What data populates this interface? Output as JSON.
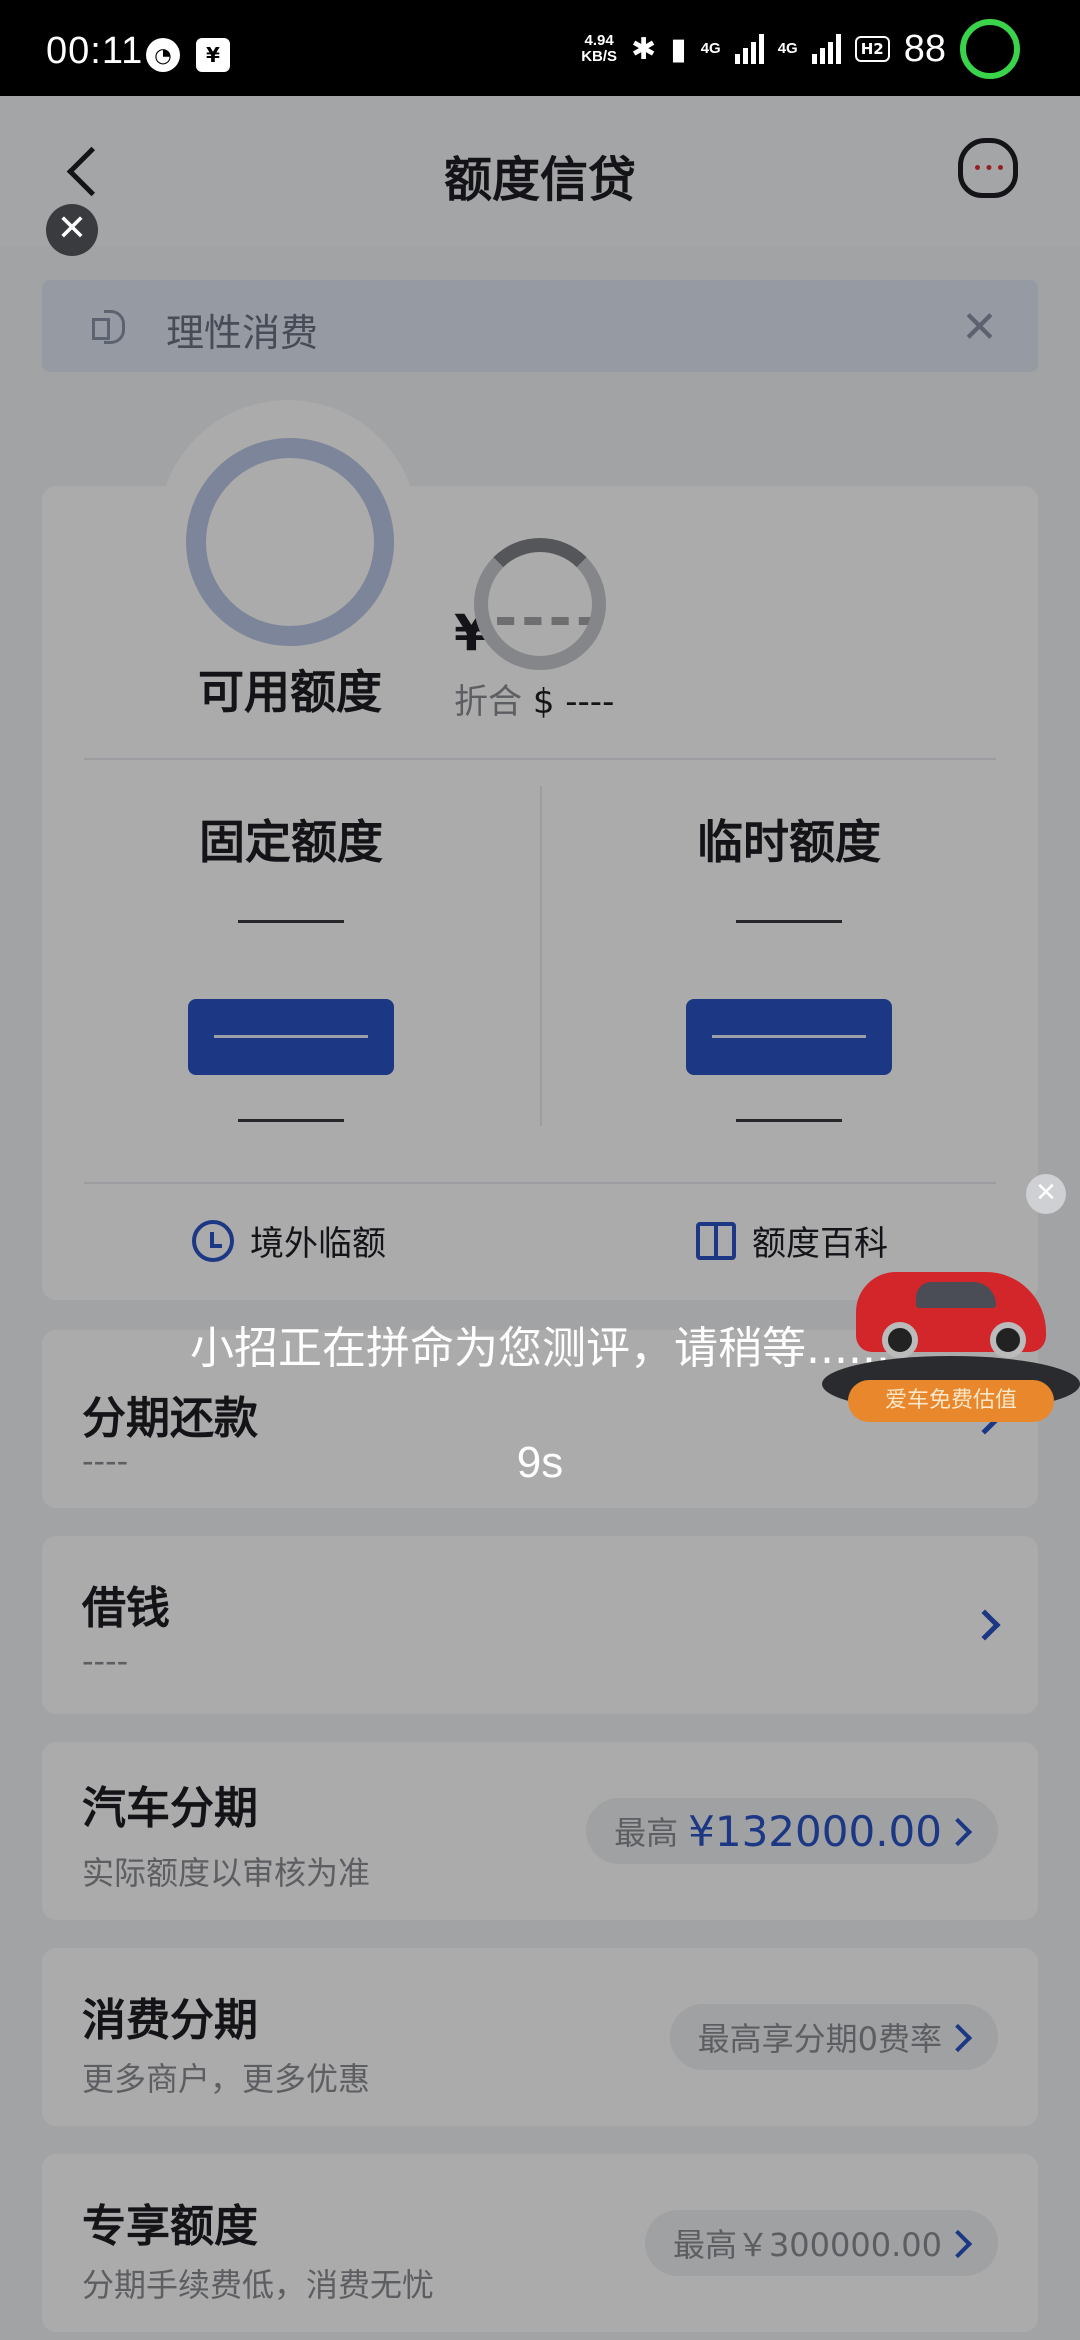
{
  "status_bar": {
    "time": "00:11",
    "net_speed_value": "4.94",
    "net_speed_unit": "KB/S",
    "sig1": "4G",
    "sig2": "4G",
    "hd": "H2",
    "battery": "88"
  },
  "nav": {
    "title": "额度信贷",
    "back_icon": "back-chevron-icon",
    "mascot_icon": "cat-mascot-icon"
  },
  "notice": {
    "text": "理性消费",
    "close_glyph": "✕"
  },
  "credit": {
    "available_label": "可用额度",
    "currency_symbol": "¥",
    "amount_placeholder": "----",
    "approx_label": "折合",
    "approx_currency": "$",
    "approx_value": "----",
    "fixed_title": "固定额度",
    "temp_title": "临时额度",
    "overseas_link": "境外临额",
    "wiki_link": "额度百科"
  },
  "rows": {
    "installment": {
      "title": "分期还款",
      "sub": "----"
    },
    "borrow": {
      "title": "借钱",
      "sub": "----"
    },
    "car": {
      "title": "汽车分期",
      "sub": "实际额度以审核为准",
      "pill_label": "最高",
      "pill_value": "¥132000.00"
    },
    "consumer": {
      "title": "消费分期",
      "sub": "更多商户，更多优惠",
      "pill_label": "最高享分期0费率"
    },
    "exclusive": {
      "title": "专享额度",
      "sub": "分期手续费低，消费无忧",
      "pill_label": "最高￥300000.00"
    }
  },
  "overlay": {
    "message": "小招正在拼命为您测评，请稍等......",
    "countdown": "9s",
    "close_glyph": "✕",
    "ad_label": "爱车免费估值"
  },
  "colors": {
    "accent": "#2a52c4",
    "battery_ring": "#3ad44a"
  }
}
